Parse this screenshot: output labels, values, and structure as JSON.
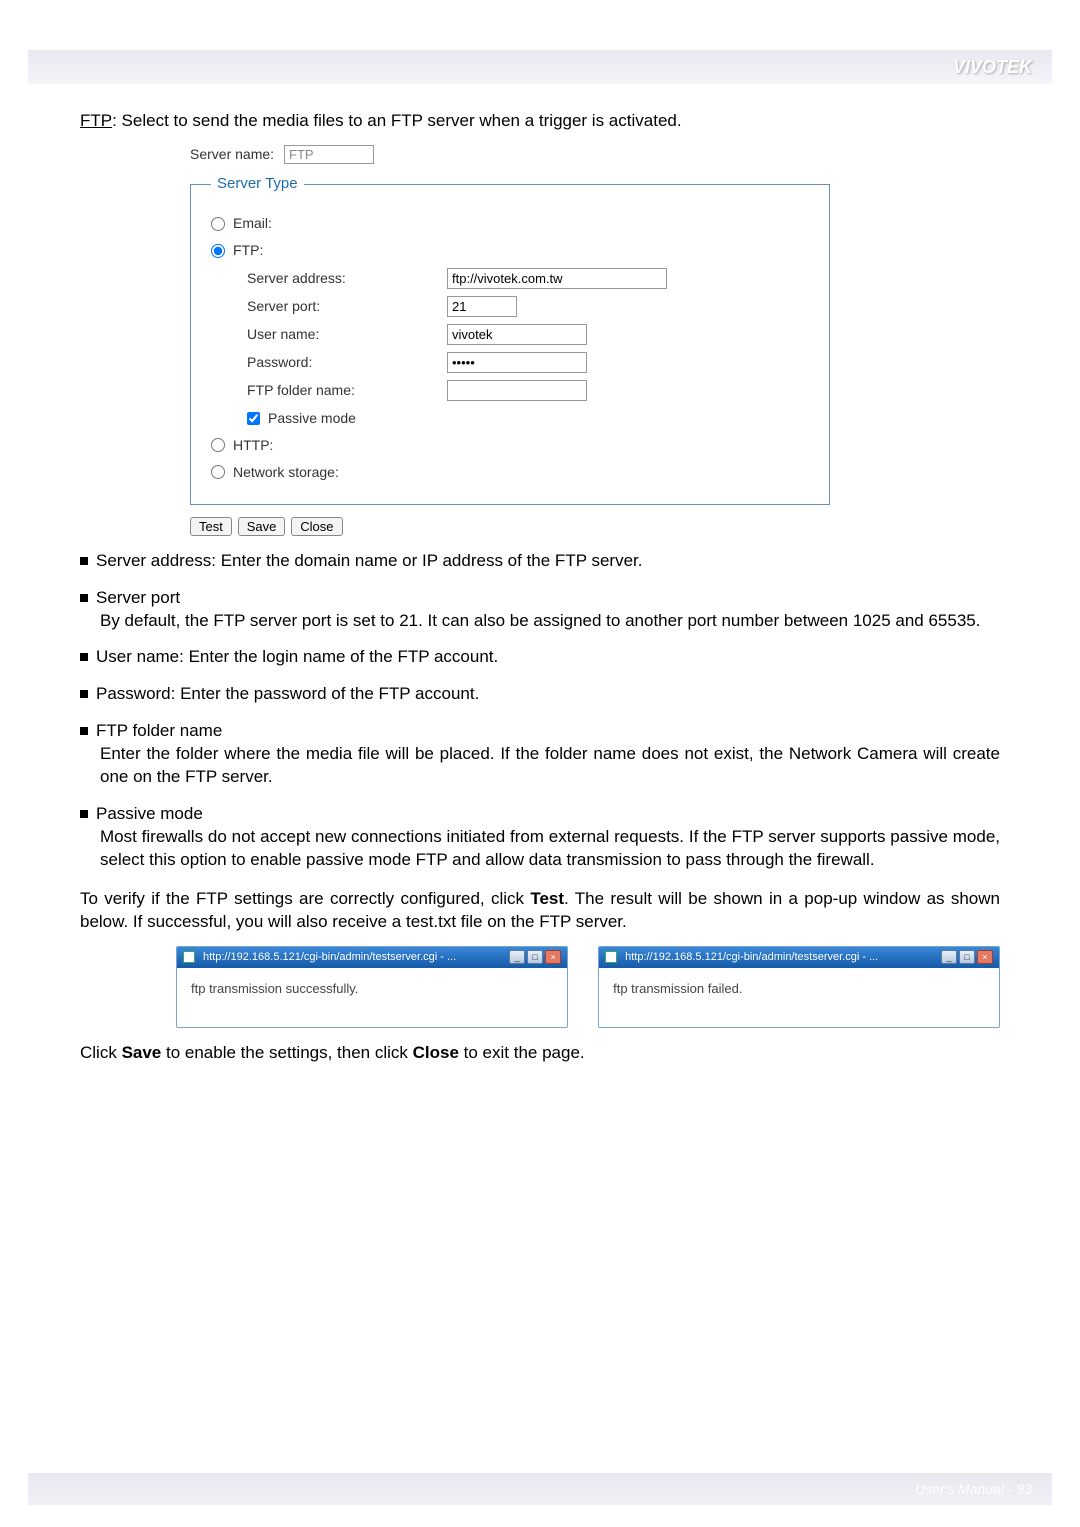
{
  "brand": "VIVOTEK",
  "intro": {
    "ftp_label": "FTP",
    "text": ": Select to send the media files to an FTP server when a trigger is activated."
  },
  "config": {
    "server_name_label": "Server name:",
    "server_name_value": "FTP",
    "legend": "Server Type",
    "email_label": "Email:",
    "ftp_label": "FTP:",
    "server_address_label": "Server address:",
    "server_address_value": "ftp://vivotek.com.tw",
    "server_port_label": "Server port:",
    "server_port_value": "21",
    "user_name_label": "User name:",
    "user_name_value": "vivotek",
    "password_label": "Password:",
    "password_value": "•••••",
    "folder_label": "FTP folder name:",
    "folder_value": "",
    "passive_label": "Passive mode",
    "http_label": "HTTP:",
    "ns_label": "Network storage:",
    "btn_test": "Test",
    "btn_save": "Save",
    "btn_close": "Close"
  },
  "bullets": {
    "server_address": "Server address: Enter the domain name or IP address of the FTP server.",
    "server_port_head": "Server port",
    "server_port_desc": "By default, the FTP server port is set to 21. It can also be assigned to another port number between 1025 and 65535.",
    "user_name": "User name: Enter the login name of the FTP account.",
    "password": "Password: Enter the password of the FTP account.",
    "folder_head": "FTP folder name",
    "folder_desc": "Enter the folder where the media file will be placed. If the folder name does not exist, the Network Camera will create one on the FTP server.",
    "passive_head": "Passive mode",
    "passive_desc": "Most firewalls do not accept new connections initiated from external requests. If the FTP server supports passive mode, select this option to enable passive mode FTP and allow data transmission to pass through the firewall."
  },
  "verify_para": {
    "pre": "To verify if the FTP settings are correctly configured, click ",
    "bold": "Test",
    "post": ". The result will be shown in a pop-up window as shown below. If successful, you will also receive a test.txt file on the FTP server."
  },
  "popups": {
    "p1_title": "http://192.168.5.121/cgi-bin/admin/testserver.cgi - ...",
    "p1_body": "ftp transmission successfully.",
    "p2_title": "http://192.168.5.121/cgi-bin/admin/testserver.cgi - ...",
    "p2_body": "ftp transmission failed."
  },
  "final": {
    "pre": "Click ",
    "b1": "Save",
    "mid": " to enable the settings, then click ",
    "b2": "Close",
    "post": " to exit the page."
  },
  "footer": {
    "manual": "User's Manual - ",
    "page": "93"
  }
}
